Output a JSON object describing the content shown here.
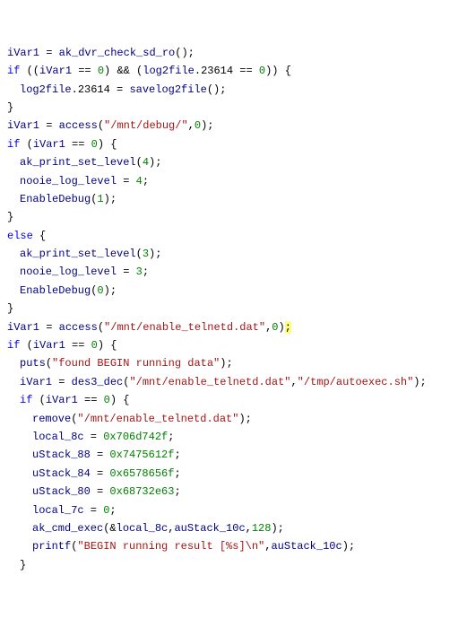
{
  "l1": {
    "a": "iVar1",
    "b": " = ",
    "c": "ak_dvr_check_sd_ro",
    "d": "();"
  },
  "l2": {
    "a": "if",
    "b": " ((",
    "c": "iVar1",
    "d": " == ",
    "e": "0",
    "f": ") && (",
    "g": "log2file",
    "h": ".",
    "i": "23614",
    "j": " == ",
    "k": "0",
    "l": ")) {"
  },
  "l3": {
    "a": "log2file",
    "b": ".",
    "c": "23614",
    "d": " = ",
    "e": "savelog2file",
    "f": "();"
  },
  "l4": "}",
  "l5": {
    "a": "iVar1",
    "b": " = ",
    "c": "access",
    "d": "(",
    "e": "\"/mnt/debug/\"",
    "f": ",",
    "g": "0",
    "h": ");"
  },
  "l6": {
    "a": "if",
    "b": " (",
    "c": "iVar1",
    "d": " == ",
    "e": "0",
    "f": ") {"
  },
  "l7": {
    "a": "ak_print_set_level",
    "b": "(",
    "c": "4",
    "d": ");"
  },
  "l8": {
    "a": "nooie_log_level",
    "b": " = ",
    "c": "4",
    "d": ";"
  },
  "l9": {
    "a": "EnableDebug",
    "b": "(",
    "c": "1",
    "d": ");"
  },
  "l10": "}",
  "l11": {
    "a": "else",
    "b": " {"
  },
  "l12": {
    "a": "ak_print_set_level",
    "b": "(",
    "c": "3",
    "d": ");"
  },
  "l13": {
    "a": "nooie_log_level",
    "b": " = ",
    "c": "3",
    "d": ";"
  },
  "l14": {
    "a": "EnableDebug",
    "b": "(",
    "c": "0",
    "d": ");"
  },
  "l15": "}",
  "l16": {
    "a": "iVar1",
    "b": " = ",
    "c": "access",
    "d": "(",
    "e": "\"/mnt/enable_telnetd.dat\"",
    "f": ",",
    "g": "0",
    "h": ")",
    "i": ";"
  },
  "l17": {
    "a": "if",
    "b": " (",
    "c": "iVar1",
    "d": " == ",
    "e": "0",
    "f": ") {"
  },
  "l18": {
    "a": "puts",
    "b": "(",
    "c": "\"found BEGIN running data\"",
    "d": ");"
  },
  "l19": {
    "a": "iVar1",
    "b": " = ",
    "c": "des3_dec",
    "d": "(",
    "e": "\"/mnt/enable_telnetd.dat\"",
    "f": ",",
    "g": "\"/tmp/autoexec.sh\"",
    "h": ");"
  },
  "l20": {
    "a": "if",
    "b": " (",
    "c": "iVar1",
    "d": " == ",
    "e": "0",
    "f": ") {"
  },
  "l21": {
    "a": "remove",
    "b": "(",
    "c": "\"/mnt/enable_telnetd.dat\"",
    "d": ");"
  },
  "l22": {
    "a": "local_8c",
    "b": " = ",
    "c": "0x706d742f",
    "d": ";"
  },
  "l23": {
    "a": "uStack_88",
    "b": " = ",
    "c": "0x7475612f",
    "d": ";"
  },
  "l24": {
    "a": "uStack_84",
    "b": " = ",
    "c": "0x6578656f",
    "d": ";"
  },
  "l25": {
    "a": "uStack_80",
    "b": " = ",
    "c": "0x68732e63",
    "d": ";"
  },
  "l26": {
    "a": "local_7c",
    "b": " = ",
    "c": "0",
    "d": ";"
  },
  "l27": {
    "a": "ak_cmd_exec",
    "b": "(&",
    "c": "local_8c",
    "d": ",",
    "e": "auStack_10c",
    "f": ",",
    "g": "128",
    "h": ");"
  },
  "l28": {
    "a": "printf",
    "b": "(",
    "c": "\"BEGIN running result [%s]\\n\"",
    "d": ",",
    "e": "auStack_10c",
    "f": ");"
  },
  "l29": "}"
}
